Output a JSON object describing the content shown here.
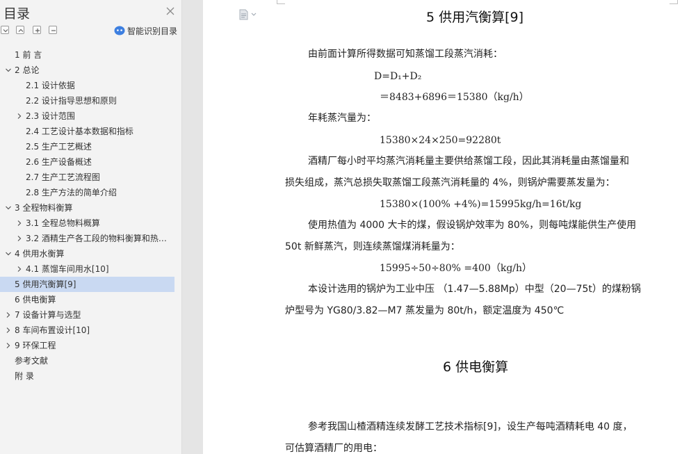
{
  "toc": {
    "title": "目录",
    "smart_label": "智能识别目录",
    "items": [
      {
        "label": "1 前  言",
        "level": 1,
        "chevron": "none",
        "selected": false
      },
      {
        "label": "2 总论",
        "level": 1,
        "chevron": "down",
        "selected": false
      },
      {
        "label": "2.1 设计依据",
        "level": 2,
        "chevron": "none",
        "selected": false
      },
      {
        "label": "2.2 设计指导思想和原则",
        "level": 2,
        "chevron": "none",
        "selected": false
      },
      {
        "label": "2.3 设计范围",
        "level": 2,
        "chevron": "right",
        "selected": false
      },
      {
        "label": "2.4 工艺设计基本数据和指标",
        "level": 2,
        "chevron": "none",
        "selected": false
      },
      {
        "label": "2.5 生产工艺概述",
        "level": 2,
        "chevron": "none",
        "selected": false
      },
      {
        "label": "2.6 生产设备概述",
        "level": 2,
        "chevron": "none",
        "selected": false
      },
      {
        "label": "2.7 生产工艺流程图",
        "level": 2,
        "chevron": "none",
        "selected": false
      },
      {
        "label": "2.8 生产方法的简单介绍",
        "level": 2,
        "chevron": "none",
        "selected": false
      },
      {
        "label": "3 全程物料衡算",
        "level": 1,
        "chevron": "down",
        "selected": false
      },
      {
        "label": "3.1 全程总物料概算",
        "level": 2,
        "chevron": "right",
        "selected": false
      },
      {
        "label": "3.2 酒精生产各工段的物料衡算和热…",
        "level": 2,
        "chevron": "right",
        "selected": false
      },
      {
        "label": "4  供用水衡算",
        "level": 1,
        "chevron": "down",
        "selected": false
      },
      {
        "label": "4.1 蒸馏车间用水[10]",
        "level": 2,
        "chevron": "right",
        "selected": false
      },
      {
        "label": "5 供用汽衡算[9]",
        "level": 1,
        "chevron": "none",
        "selected": true
      },
      {
        "label": "6 供电衡算",
        "level": 1,
        "chevron": "none",
        "selected": false
      },
      {
        "label": "7 设备计算与选型",
        "level": 1,
        "chevron": "right",
        "selected": false
      },
      {
        "label": "8 车间布置设计[10]",
        "level": 1,
        "chevron": "right",
        "selected": false
      },
      {
        "label": "9 环保工程",
        "level": 1,
        "chevron": "right",
        "selected": false
      },
      {
        "label": "参考文献",
        "level": 1,
        "chevron": "none",
        "selected": false
      },
      {
        "label": "附  录",
        "level": 1,
        "chevron": "none",
        "selected": false
      }
    ]
  },
  "document": {
    "heading5": "5 供用汽衡算[9]",
    "p1": "由前面计算所得数据可知蒸馏工段蒸汽消耗：",
    "formula_d": "D=D₁+D₂",
    "formula_d_value": "＝8483+6896＝15380（kg/h）",
    "p2": "年耗蒸汽量为：",
    "formula_year": "15380×24×250=92280t",
    "p3_line1": "酒精厂每小时平均蒸汽消耗量主要供给蒸馏工段，因此其消耗量由蒸馏量和",
    "p3_line2": "损失组成，蒸汽总损失取蒸馏工段蒸汽消耗量的 4%，则锅炉需要蒸发量为：",
    "formula_evap": "15380×(100% +4%)=15995kg/h=16t/kg",
    "p4_line1": "使用热值为 4000 大卡的煤，假设锅炉效率为 80%，则每吨煤能供生产使用",
    "p4_line2": "50t 新鲜蒸汽，则连续蒸馏煤消耗量为：",
    "formula_coal": "15995÷50÷80% =400（kg/h）",
    "p5_line1": "本设计选用的锅炉为工业中压  （1.47—5.88Mp）中型（20—75t）的煤粉锅",
    "p5_line2": "炉型号为  YG80/3.82—M7  蒸发量为 80t/h，额定温度为 450℃",
    "heading6": "6 供电衡算",
    "p6_line1": "参考我国山楂酒精连续发酵工艺技术指标[9]，设生产每吨酒精耗电 40 度，",
    "p6_line2": "可估算酒精厂的用电："
  },
  "colors": {
    "sidebar_bg": "#f3f3f3",
    "selected_bg": "#c9d9f2",
    "smart_icon": "#3d7fe0",
    "page_bg": "#ffffff",
    "canvas_bg": "#e5e5e5"
  },
  "icons": [
    "close-icon",
    "collapse-all-icon",
    "expand-icon",
    "add-icon",
    "remove-icon",
    "smart-toc-icon",
    "chevron-down-icon",
    "chevron-right-icon",
    "document-icon"
  ]
}
